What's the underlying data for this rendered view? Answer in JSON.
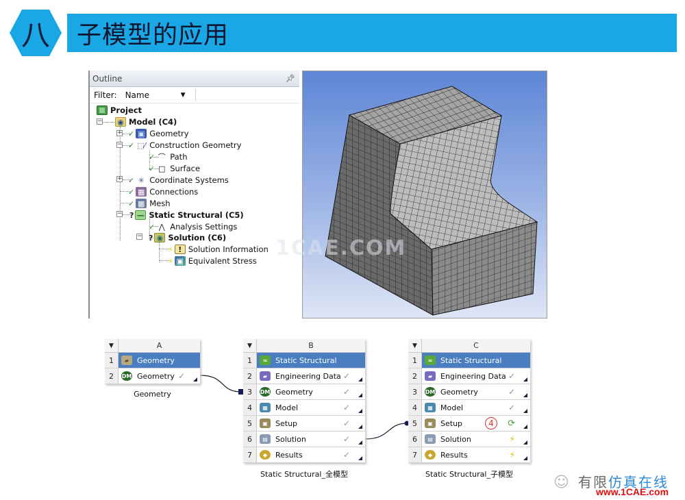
{
  "header": {
    "section_number": "八",
    "title": "子模型的应用",
    "accent_color": "#1aa7e6"
  },
  "outline": {
    "title": "Outline",
    "pin_icon": "pin-icon",
    "filter_label": "Filter:",
    "filter_value": "Name",
    "filter_text": "",
    "tree": [
      {
        "label": "Project",
        "bold": true,
        "icon": "project-icon",
        "status": ""
      },
      {
        "label": "Model (C4)",
        "bold": true,
        "icon": "model-icon",
        "status": ""
      },
      {
        "label": "Geometry",
        "bold": false,
        "icon": "geometry-icon",
        "status": "check"
      },
      {
        "label": "Construction Geometry",
        "bold": false,
        "icon": "construction-geometry-icon",
        "status": "check"
      },
      {
        "label": "Path",
        "bold": false,
        "icon": "path-icon",
        "status": "check"
      },
      {
        "label": "Surface",
        "bold": false,
        "icon": "surface-icon",
        "status": "check"
      },
      {
        "label": "Coordinate Systems",
        "bold": false,
        "icon": "coordinate-systems-icon",
        "status": "check"
      },
      {
        "label": "Connections",
        "bold": false,
        "icon": "connections-icon",
        "status": "check"
      },
      {
        "label": "Mesh",
        "bold": false,
        "icon": "mesh-icon",
        "status": "check"
      },
      {
        "label": "Static Structural (C5)",
        "bold": true,
        "icon": "static-structural-icon",
        "status": "question"
      },
      {
        "label": "Analysis Settings",
        "bold": false,
        "icon": "analysis-settings-icon",
        "status": "check"
      },
      {
        "label": "Solution (C6)",
        "bold": true,
        "icon": "solution-icon",
        "status": "question"
      },
      {
        "label": "Solution Information",
        "bold": false,
        "icon": "solution-information-icon",
        "status": "lightning"
      },
      {
        "label": "Equivalent Stress",
        "bold": false,
        "icon": "equivalent-stress-icon",
        "status": "lightning"
      }
    ]
  },
  "viewer": {
    "description": "Hex-meshed L-shaped block with fillet",
    "watermark": "1CAE.COM"
  },
  "schematic": {
    "systems": [
      {
        "id": "A",
        "caption": "Geometry",
        "rows": [
          {
            "num": "1",
            "label": "Geometry",
            "icon": "geometry-box-icon",
            "status": "",
            "selected": true
          },
          {
            "num": "2",
            "label": "Geometry",
            "icon": "dm-icon",
            "status": "check",
            "selected": false
          }
        ]
      },
      {
        "id": "B",
        "caption": "Static Structural_全模型",
        "rows": [
          {
            "num": "1",
            "label": "Static Structural",
            "icon": "static-structural-icon",
            "status": "",
            "selected": true
          },
          {
            "num": "2",
            "label": "Engineering Data",
            "icon": "engineering-data-icon",
            "status": "check",
            "selected": false
          },
          {
            "num": "3",
            "label": "Geometry",
            "icon": "dm-icon",
            "status": "check",
            "selected": false
          },
          {
            "num": "4",
            "label": "Model",
            "icon": "model-icon",
            "status": "check",
            "selected": false
          },
          {
            "num": "5",
            "label": "Setup",
            "icon": "setup-icon",
            "status": "check",
            "selected": false
          },
          {
            "num": "6",
            "label": "Solution",
            "icon": "solution-icon",
            "status": "check",
            "selected": false
          },
          {
            "num": "7",
            "label": "Results",
            "icon": "results-icon",
            "status": "check",
            "selected": false
          }
        ]
      },
      {
        "id": "C",
        "caption": "Static Structural_子模型",
        "rows": [
          {
            "num": "1",
            "label": "Static Structural",
            "icon": "static-structural-icon",
            "status": "",
            "selected": true
          },
          {
            "num": "2",
            "label": "Engineering Data",
            "icon": "engineering-data-icon",
            "status": "check",
            "selected": false
          },
          {
            "num": "3",
            "label": "Geometry",
            "icon": "dm-icon",
            "status": "check",
            "selected": false
          },
          {
            "num": "4",
            "label": "Model",
            "icon": "model-icon",
            "status": "check",
            "selected": false
          },
          {
            "num": "5",
            "label": "Setup",
            "icon": "setup-icon",
            "status": "refresh",
            "selected": false,
            "annotation": "4"
          },
          {
            "num": "6",
            "label": "Solution",
            "icon": "solution-icon",
            "status": "lightning",
            "selected": false
          },
          {
            "num": "7",
            "label": "Results",
            "icon": "results-icon",
            "status": "lightning",
            "selected": false
          }
        ]
      }
    ]
  },
  "logo": {
    "text_gray": "有限",
    "text_blue": "仿真在线",
    "url": "www.1CAE.com"
  }
}
